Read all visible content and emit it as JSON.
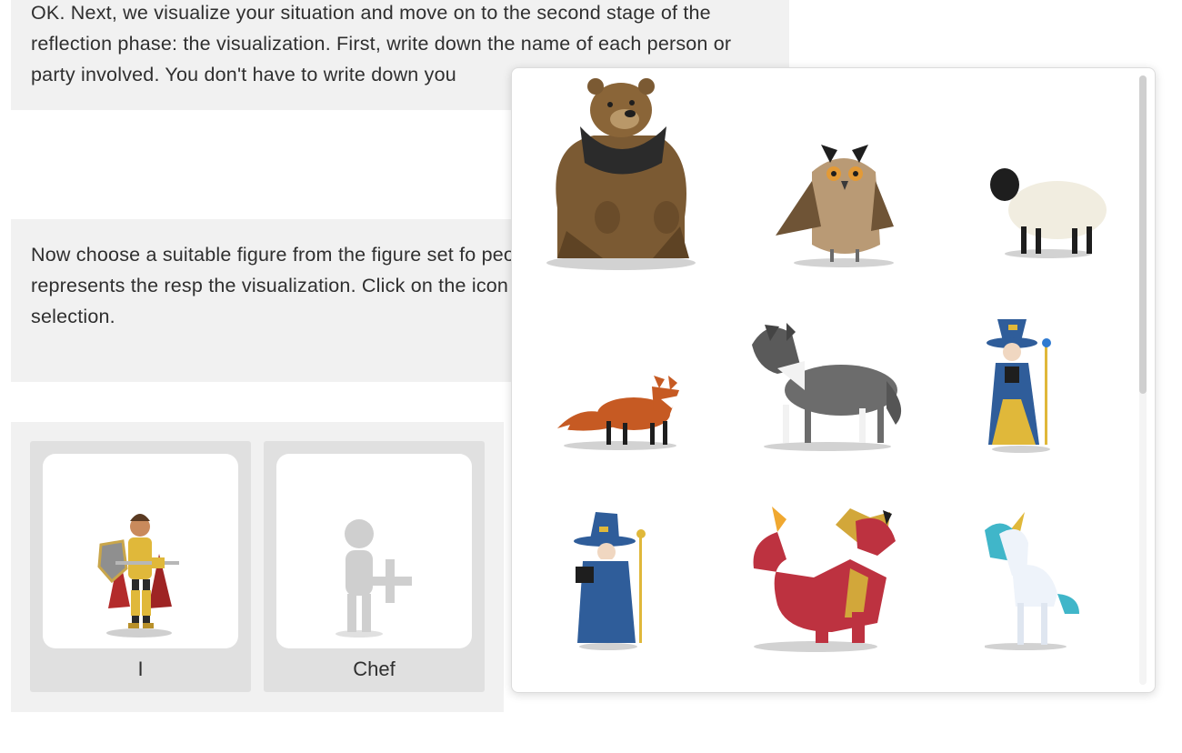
{
  "messages": {
    "intro": "OK. Next, we visualize your situation and move on to the second stage of the reflection phase: the visualization. First, write down the name of each person or party involved. You don't have to write down you",
    "choose": "Now choose a suitable figure from the figure set fo people or parties involved. This represents the resp the visualization. Click on the icon above next to th character selection."
  },
  "figures": [
    {
      "name": "I",
      "character": "knight"
    },
    {
      "name": "Chef",
      "character": "placeholder-add"
    }
  ],
  "picker": {
    "characters": [
      "bear",
      "owl",
      "sheep",
      "fox",
      "wolf",
      "witch",
      "wizard",
      "dragon",
      "unicorn"
    ]
  },
  "colors": {
    "panel_bg": "#f1f1f1",
    "card_bg": "#e0e0e0",
    "text": "#2f2f2f"
  }
}
